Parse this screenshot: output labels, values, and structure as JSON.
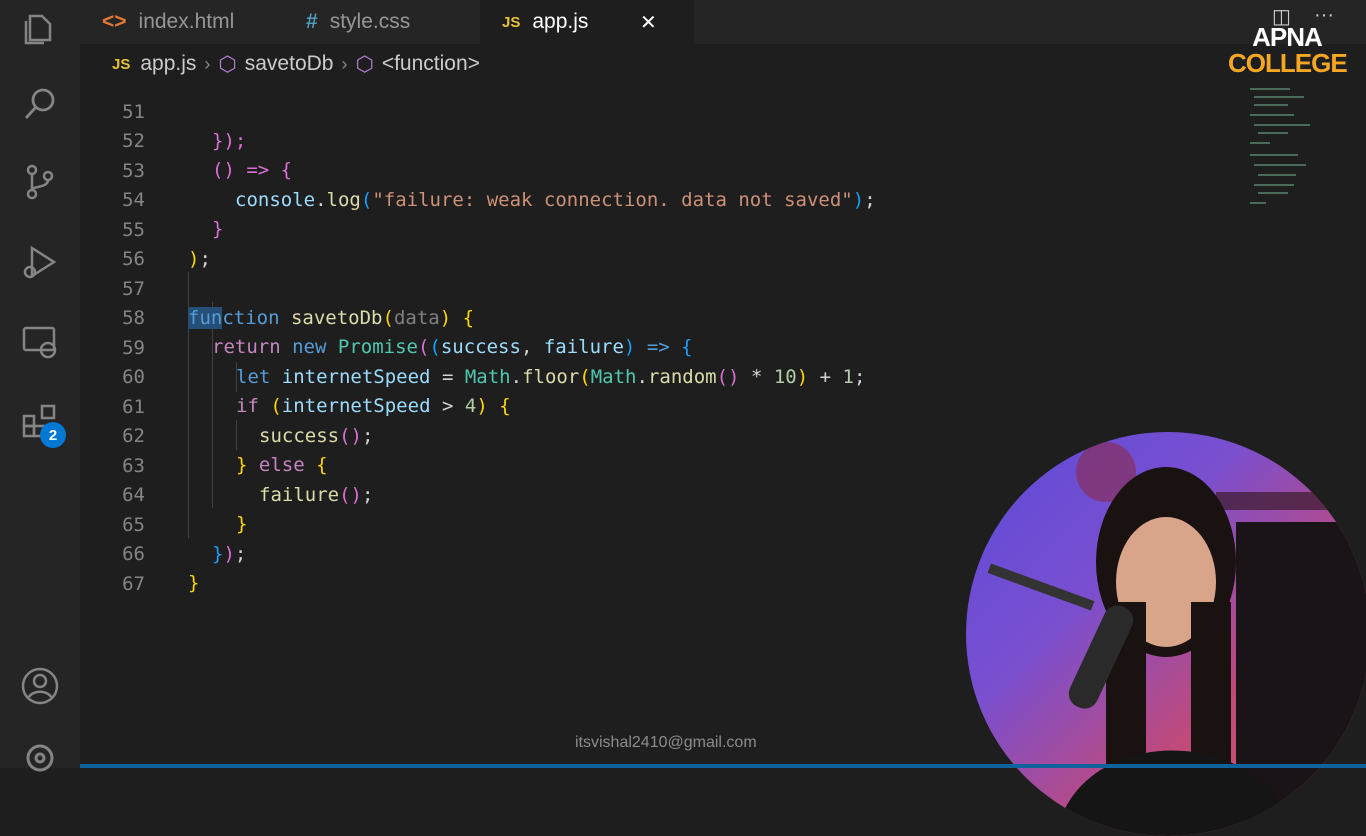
{
  "tabs": [
    {
      "icon": "<>",
      "label": "index.html"
    },
    {
      "icon": "#",
      "label": "style.css"
    },
    {
      "icon": "JS",
      "label": "app.js",
      "close": "✕"
    }
  ],
  "breadcrumb": {
    "file_icon": "JS",
    "file": "app.js",
    "symbol1": "savetoDb",
    "symbol2": "<function>"
  },
  "activity": {
    "items": [
      "explorer-icon",
      "search-icon",
      "source-control-icon",
      "run-debug-icon",
      "remote-explorer-icon",
      "extensions-icon",
      "account-icon",
      "settings-gear-icon"
    ],
    "extensions_badge": "2"
  },
  "code": {
    "top_partial": "51",
    "lines": [
      {
        "n": "52"
      },
      {
        "n": "53"
      },
      {
        "n": "54"
      },
      {
        "n": "55"
      },
      {
        "n": "56"
      },
      {
        "n": "57"
      },
      {
        "n": "58"
      },
      {
        "n": "59"
      },
      {
        "n": "60"
      },
      {
        "n": "61"
      },
      {
        "n": "62"
      },
      {
        "n": "63"
      },
      {
        "n": "64"
      },
      {
        "n": "65"
      },
      {
        "n": "66"
      },
      {
        "n": "67"
      }
    ],
    "t": {
      "l51": "});",
      "l52_open": "() => {",
      "console": "console",
      "log": "log",
      "failure_msg": "\"failure: weak connection. data not saved\"",
      "function_kw_sel": "fun",
      "function_kw_rest": "ction",
      "savetoDb": "savetoDb",
      "data_param": "data",
      "return": "return",
      "new": "new",
      "Promise": "Promise",
      "success": "success",
      "failure": "failure",
      "let": "let",
      "internetSpeed": "internetSpeed",
      "Math": "Math",
      "floor": "floor",
      "random": "random",
      "ten": "10",
      "one": "1",
      "if": "if",
      "four": "4",
      "else": "else"
    }
  },
  "logo": {
    "line1": "APNA",
    "line2": "COLLEGE"
  },
  "watermark_email": "itsvishal2410@gmail.com",
  "window_icons": {
    "split": "◫",
    "more": "···"
  }
}
